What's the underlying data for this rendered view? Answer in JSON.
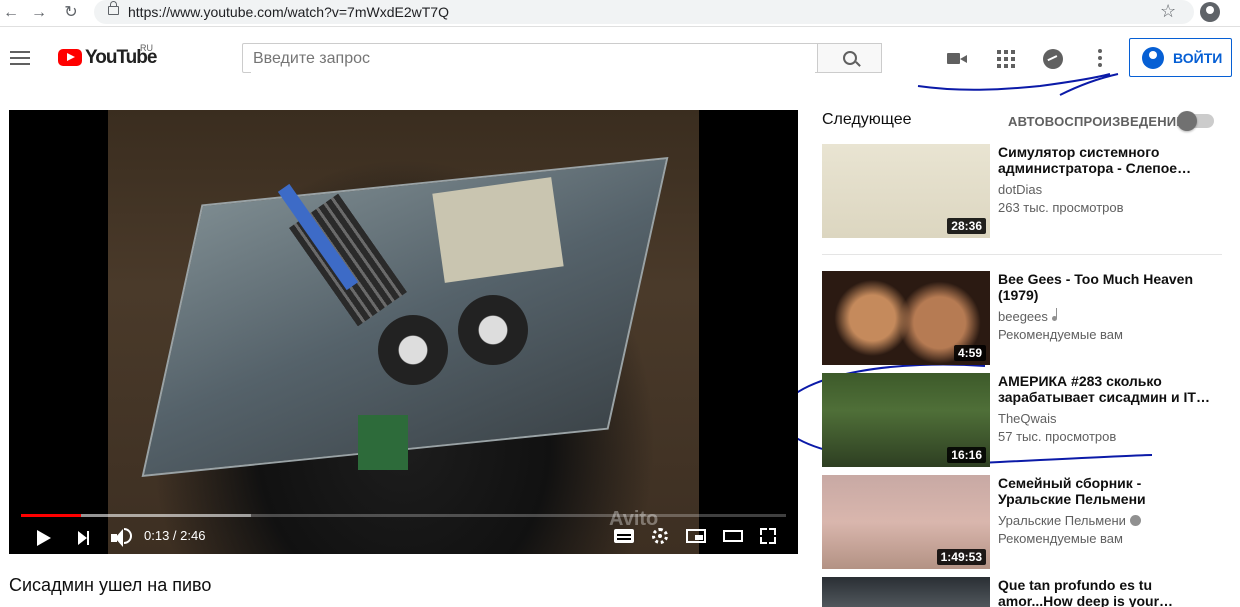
{
  "browser": {
    "url": "https://www.youtube.com/watch?v=7mWxdE2wT7Q"
  },
  "header": {
    "logo": "YouTube",
    "region": "RU",
    "search_placeholder": "Введите запрос",
    "signin_label": "ВОЙТИ"
  },
  "player": {
    "time": "0:13 / 2:46",
    "watermark": "Avito",
    "progress_played_fraction": 0.078,
    "progress_loaded_fraction": 0.3
  },
  "video": {
    "title": "Сисадмин ушел на пиво"
  },
  "sidebar": {
    "up_next": "Следующее",
    "autoplay": "АВТОВОСПРОИЗВЕДЕНИЕ",
    "autoplay_on": false,
    "items": [
      {
        "title": "Симулятор системного администратора - Слепое…",
        "channel": "dotDias",
        "meta": "263 тыс. просмотров",
        "duration": "28:36"
      },
      {
        "title": "Bee Gees - Too Much Heaven (1979)",
        "channel": "beegees",
        "meta": "Рекомендуемые вам",
        "duration": "4:59"
      },
      {
        "title": "АМЕРИКА #283 сколько зарабатывает сисадмин и IT…",
        "channel": "TheQwais",
        "meta": "57 тыс. просмотров",
        "duration": "16:16"
      },
      {
        "title": "Семейный сборник - Уральские Пельмени",
        "channel": "Уральские Пельмени",
        "meta": "Рекомендуемые вам",
        "duration": "1:49:53"
      },
      {
        "title": "Que tan profundo es tu amor...How deep is your…",
        "channel": "",
        "meta": "",
        "duration": ""
      }
    ]
  }
}
